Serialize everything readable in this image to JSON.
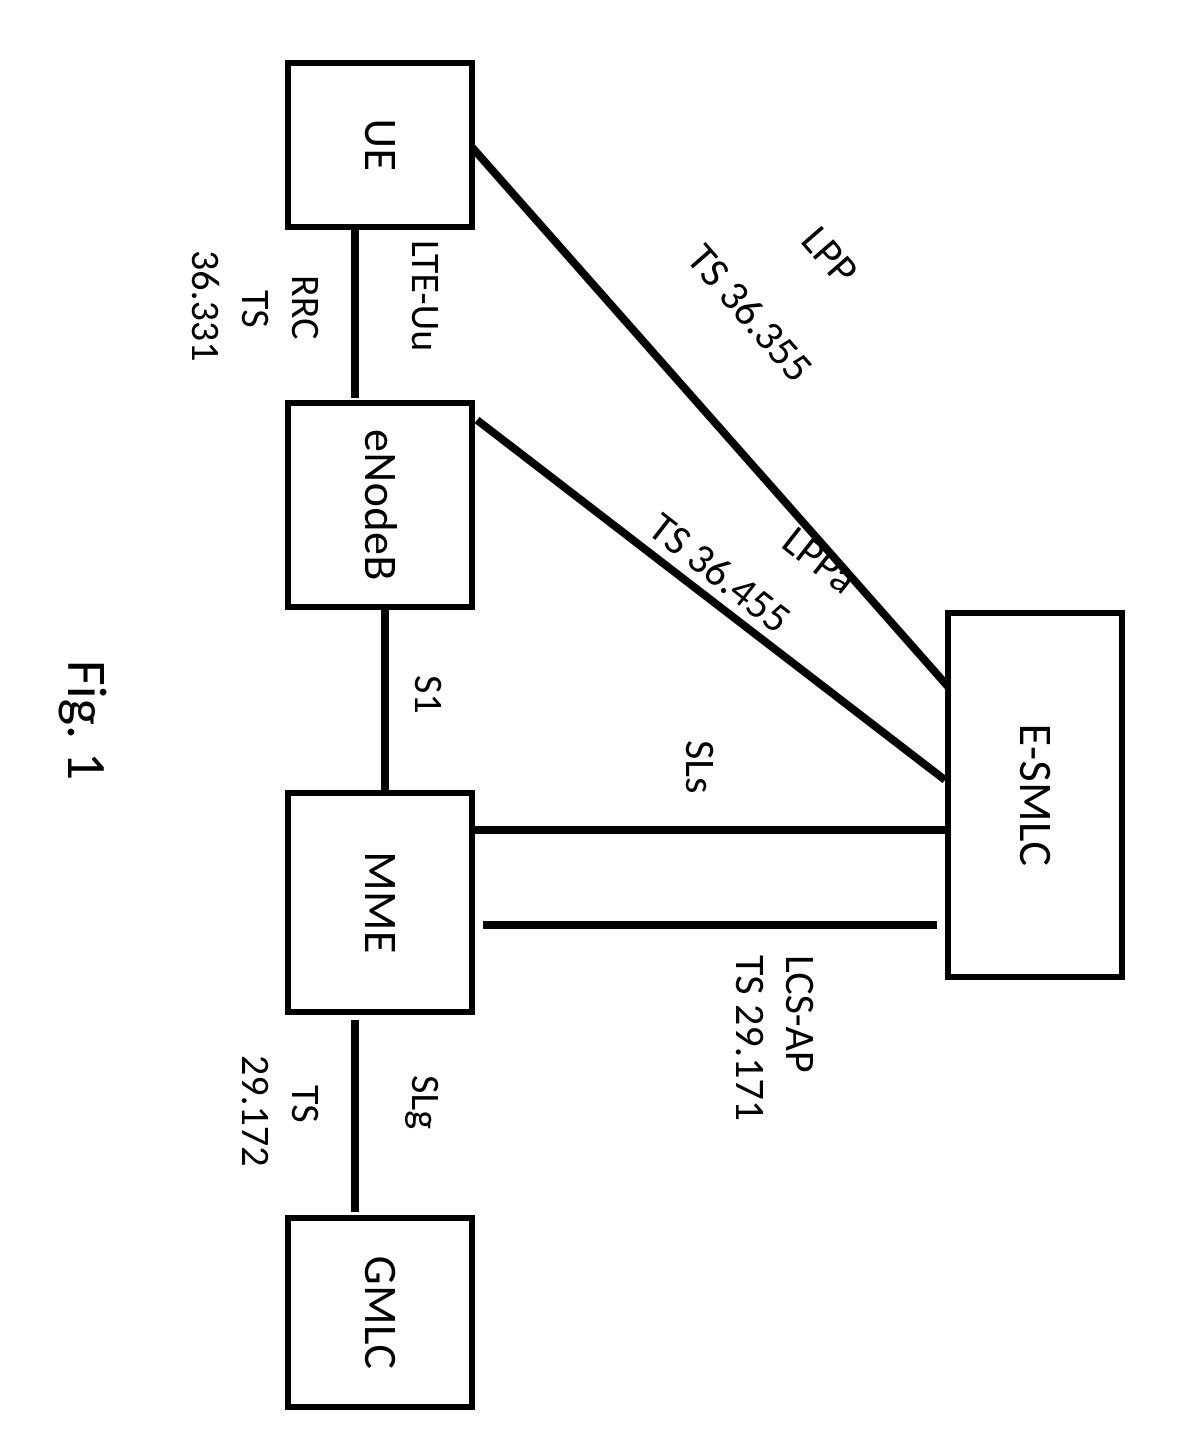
{
  "figure_caption": "Fig. 1",
  "nodes": {
    "esmlc": "E-SMLC",
    "ue": "UE",
    "enodeb": "eNodeB",
    "mme": "MME",
    "gmlc": "GMLC"
  },
  "links": {
    "lpp": {
      "name": "LPP",
      "spec": "TS 36.355"
    },
    "lppa": {
      "name": "LPPa",
      "spec": "TS 36.455"
    },
    "sls": "SLs",
    "lcsap": {
      "name": "LCS-AP",
      "spec": "TS 29.171"
    },
    "lte_uu": "LTE-Uu",
    "rrc": {
      "name": "RRC",
      "spec_a": "TS",
      "spec_b": "36.331"
    },
    "s1": "S1",
    "slg": {
      "name": "SLg",
      "spec_a": "TS",
      "spec_b": "29.172"
    }
  }
}
